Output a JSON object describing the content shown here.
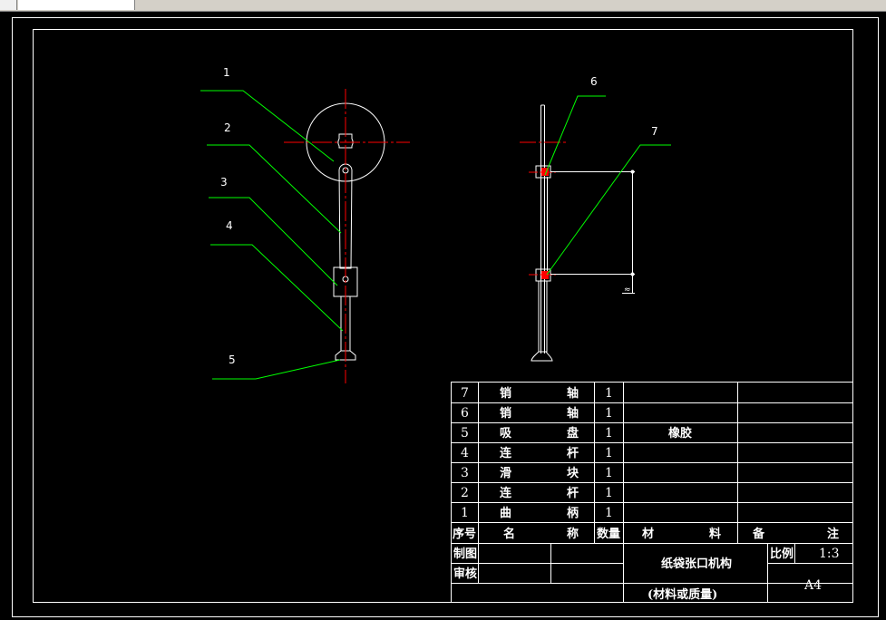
{
  "callouts": {
    "c1": "1",
    "c2": "2",
    "c3": "3",
    "c4": "4",
    "c5": "5",
    "c6": "6",
    "c7": "7"
  },
  "dimension_label": "≈",
  "parts_table": {
    "rows": [
      {
        "no": "7",
        "name_a": "销",
        "name_b": "轴",
        "qty": "1",
        "material": "",
        "note": ""
      },
      {
        "no": "6",
        "name_a": "销",
        "name_b": "轴",
        "qty": "1",
        "material": "",
        "note": ""
      },
      {
        "no": "5",
        "name_a": "吸",
        "name_b": "盘",
        "qty": "1",
        "material": "橡胶",
        "note": ""
      },
      {
        "no": "4",
        "name_a": "连",
        "name_b": "杆",
        "qty": "1",
        "material": "",
        "note": ""
      },
      {
        "no": "3",
        "name_a": "滑",
        "name_b": "块",
        "qty": "1",
        "material": "",
        "note": ""
      },
      {
        "no": "2",
        "name_a": "连",
        "name_b": "杆",
        "qty": "1",
        "material": "",
        "note": ""
      },
      {
        "no": "1",
        "name_a": "曲",
        "name_b": "柄",
        "qty": "1",
        "material": "",
        "note": ""
      }
    ],
    "header": {
      "no": "序号",
      "name_a": "名",
      "name_b": "称",
      "qty": "数量",
      "material_a": "材",
      "material_b": "料",
      "note_a": "备",
      "note_b": "注"
    }
  },
  "title_block": {
    "drawn_label": "制图",
    "checked_label": "审核",
    "title": "纸袋张口机构",
    "material_mass": "(材料或质量)",
    "scale_label": "比例",
    "scale_value": "1:3",
    "sheet_size": "A4"
  },
  "colors": {
    "outline": "#ffffff",
    "center_line": "#ff0000",
    "leader": "#00ff00",
    "pin_fill": "#ff0000",
    "background": "#000000"
  }
}
